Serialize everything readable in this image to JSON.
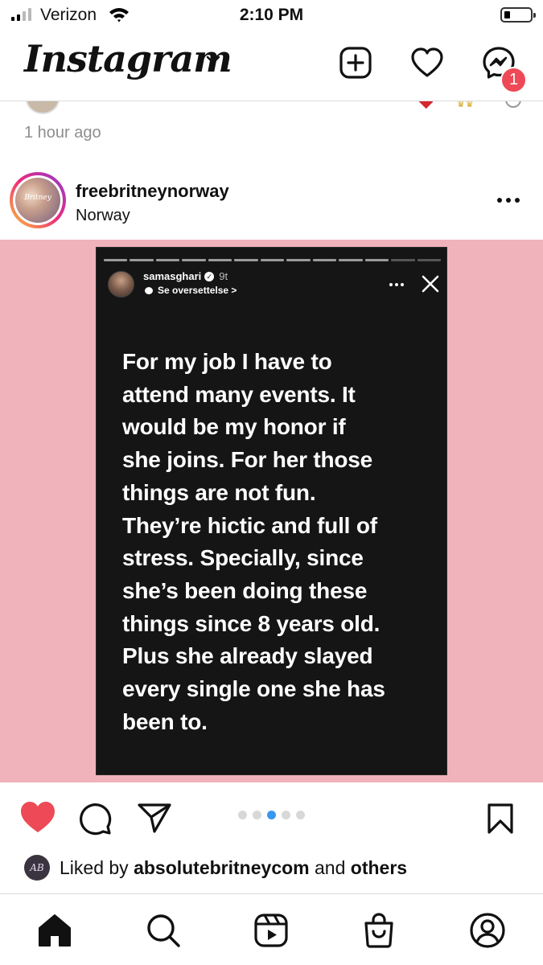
{
  "status_bar": {
    "carrier": "Verizon",
    "time": "2:10 PM",
    "signal_bars": 2,
    "wifi_icon": "wifi-icon",
    "battery_level": 0.2
  },
  "header": {
    "logo": "Instagram",
    "icons": [
      "chevron-down-icon",
      "new-post-icon",
      "activity-heart-icon",
      "messenger-icon"
    ],
    "messenger_badge": "1"
  },
  "previous_post": {
    "time_ago": "1 hour ago"
  },
  "post": {
    "username": "freebritneynorway",
    "location": "Norway",
    "avatar_text": "Britney",
    "media_background": "#f0b3bb",
    "story": {
      "username": "samasghari",
      "time": "9t",
      "translate": "Se oversettelse",
      "translate_chevron": ">",
      "verified_check": "✓",
      "progress_segments": 13,
      "progress_current": 11,
      "lines": [
        "For my job I have to",
        "attend many events. It",
        "would be my honor if",
        "she joins. For her those",
        "things are not fun.",
        "They’re hictic and full of",
        "stress. Specially, since",
        "she’s been doing these",
        "things since 8 years old.",
        "Plus she already slayed",
        "every single one she has",
        "been to."
      ]
    },
    "actions": {
      "liked": true,
      "icons": [
        "heart-filled-icon",
        "comment-icon",
        "share-icon",
        "bookmark-icon"
      ],
      "carousel_count": 5,
      "carousel_active": 3
    },
    "likes": {
      "avatar_initials": "AB",
      "prefix": "Liked by ",
      "user": "absolutebritneycom",
      "middle": " and ",
      "others": "others"
    }
  },
  "bottom_nav": {
    "items": [
      "home-icon",
      "search-icon",
      "reels-icon",
      "shop-icon",
      "profile-icon"
    ]
  },
  "colors": {
    "accent_blue": "#3897f0",
    "like_red": "#ed4956",
    "badge_red": "#ed4956"
  }
}
